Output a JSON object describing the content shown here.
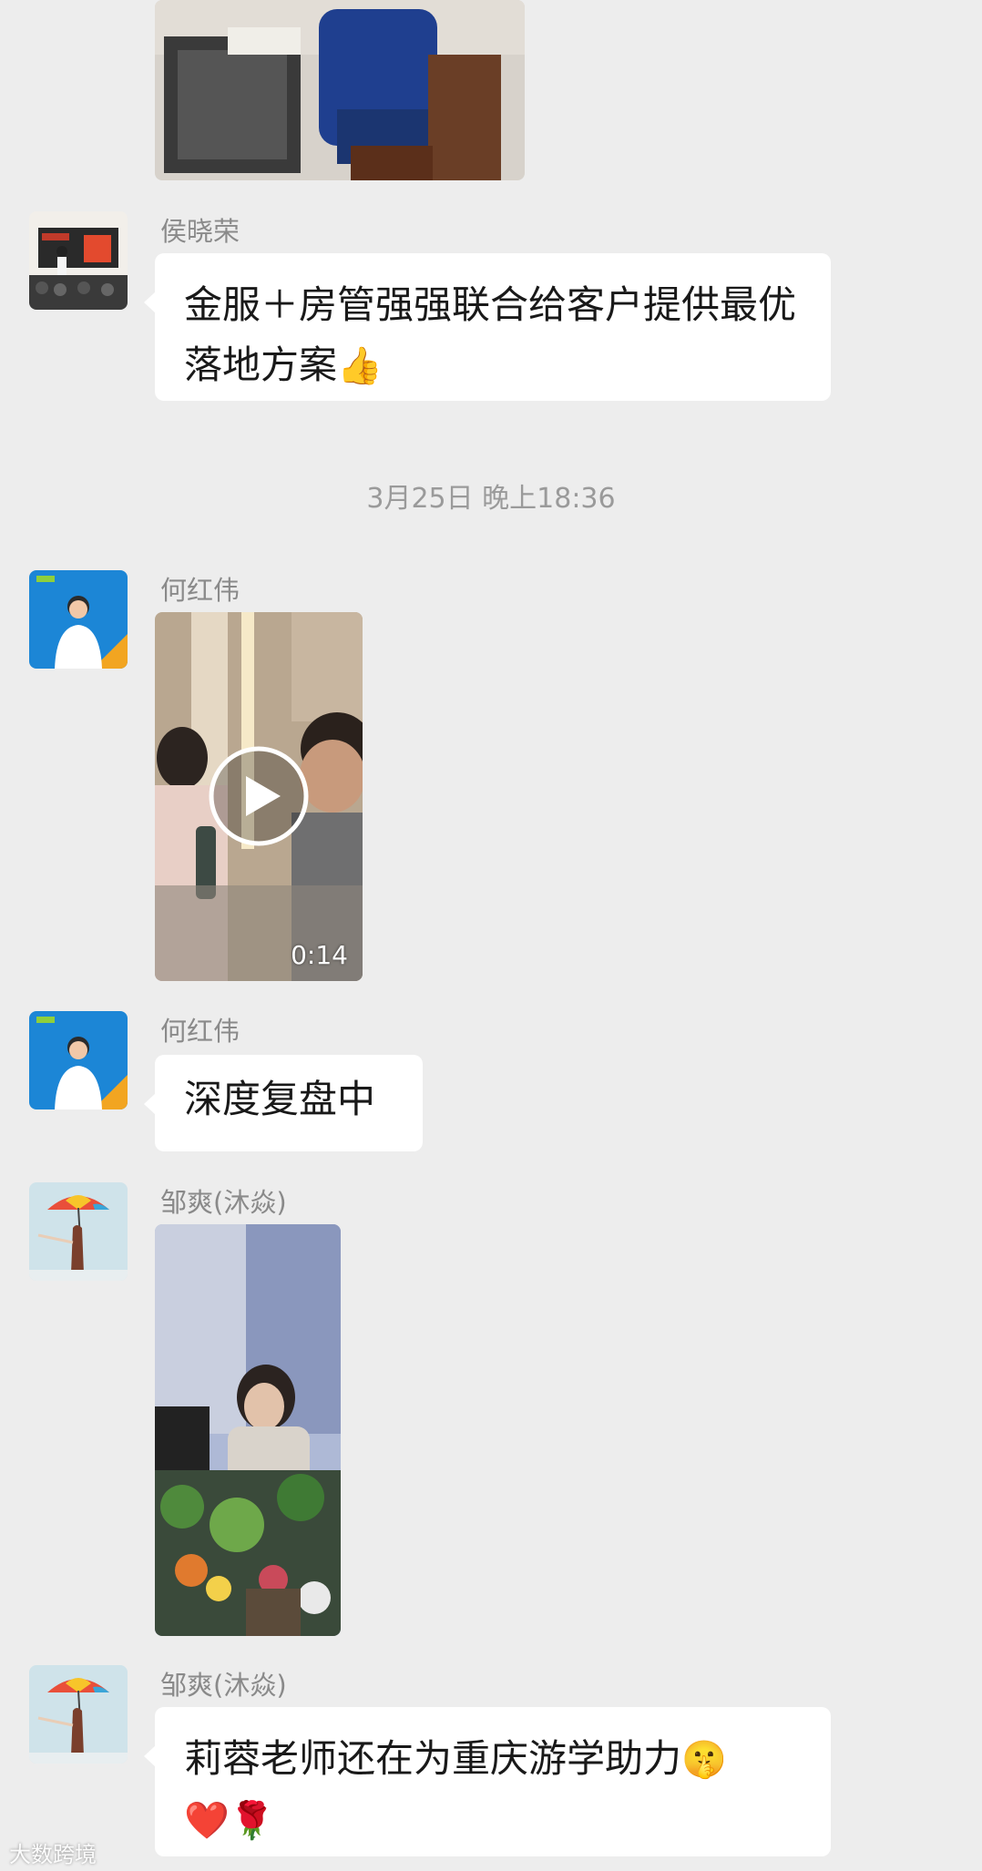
{
  "messages": [
    {
      "sender": "侯晓荣",
      "text": "金服＋房管强强联合给客户提供最优落地方案",
      "emoji": "👍"
    },
    {
      "sender": "何红伟",
      "video_duration": "0:14"
    },
    {
      "sender": "何红伟",
      "text": "深度复盘中"
    },
    {
      "sender": "邹爽(沐焱)"
    },
    {
      "sender": "邹爽(沐焱)",
      "text": "莉蓉老师还在为重庆游学助力",
      "emoji_1": "🤫",
      "emoji_2": "❤️",
      "emoji_3": "🌹"
    }
  ],
  "timestamp": "3月25日 晚上18:36",
  "watermark": "大数跨境",
  "colors": {
    "background": "#ededed",
    "bubble": "#ffffff",
    "sender_name": "#8a8a8a",
    "timestamp": "#9a9a9a"
  }
}
